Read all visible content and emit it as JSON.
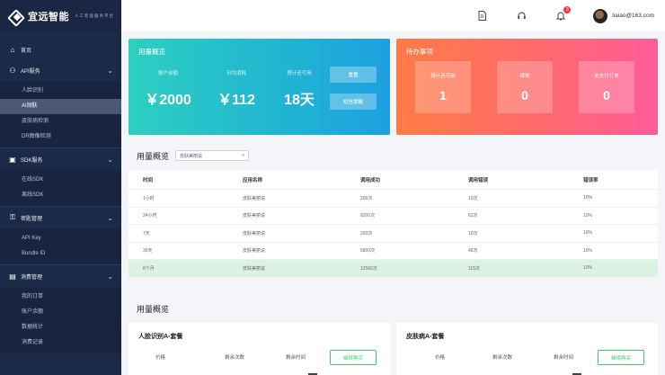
{
  "brand": {
    "name": "宜远智能",
    "tagline": "人工智能服务平台"
  },
  "sidebar": {
    "home": "首页",
    "groups": [
      {
        "label": "API服务",
        "items": [
          "人脸识别",
          "AI测肤",
          "皮肤病检测",
          "DR图像检测"
        ]
      },
      {
        "label": "SDK服务",
        "items": [
          "在线SDK",
          "离线SDK"
        ]
      },
      {
        "label": "密匙管理",
        "items": [
          "API Key",
          "Bundle ID"
        ]
      },
      {
        "label": "消费管理",
        "items": [
          "我的订单",
          "账户余额",
          "数据统计",
          "消费记录"
        ]
      }
    ],
    "active_item": "AI测肤"
  },
  "header": {
    "icons": [
      "document-icon",
      "headset-icon",
      "bell-icon"
    ],
    "notification_count": "3",
    "user_email": "liaiao@163.com"
  },
  "usage_card": {
    "title": "用量概览",
    "stats": [
      {
        "label": "账户余额",
        "value": "￥2000"
      },
      {
        "label": "日均消耗",
        "value": "￥112"
      },
      {
        "label": "预计还可用",
        "value": "18天"
      }
    ],
    "buttons": [
      "重置",
      "短信提醒"
    ]
  },
  "todo_card": {
    "title": "待办事项",
    "items": [
      {
        "label": "预计还可用",
        "value": "1"
      },
      {
        "label": "续费",
        "value": "0"
      },
      {
        "label": "未支付订单",
        "value": "0"
      }
    ]
  },
  "usage_table": {
    "title": "用量概览",
    "select_value": "皮肤美丽说",
    "columns": [
      "时间",
      "应用名称",
      "调用成功",
      "调用错误",
      "错误率"
    ],
    "rows": [
      [
        "1小时",
        "皮肤美丽说",
        "200次",
        "10次",
        "10%"
      ],
      [
        "24小时",
        "皮肤美丽说",
        "8200次",
        "62次",
        "10%"
      ],
      [
        "7天",
        "皮肤美丽说",
        "200次",
        "10次",
        "10%"
      ],
      [
        "30天",
        "皮肤美丽说",
        "5800次",
        "48次",
        "10%"
      ],
      [
        "6个月",
        "皮肤美丽说",
        "12560次",
        "115次",
        "10%"
      ]
    ],
    "highlighted_row": 4
  },
  "packages": {
    "title": "用量概览",
    "cards": [
      {
        "name": "人脸识别A-套餐",
        "cols": [
          "价格",
          "剩余次数",
          "剩余时间"
        ],
        "button": "继续购买"
      },
      {
        "name": "皮肤病A-套餐",
        "cols": [
          "价格",
          "剩余次数",
          "剩余时间"
        ],
        "button": "继续购买"
      }
    ]
  }
}
